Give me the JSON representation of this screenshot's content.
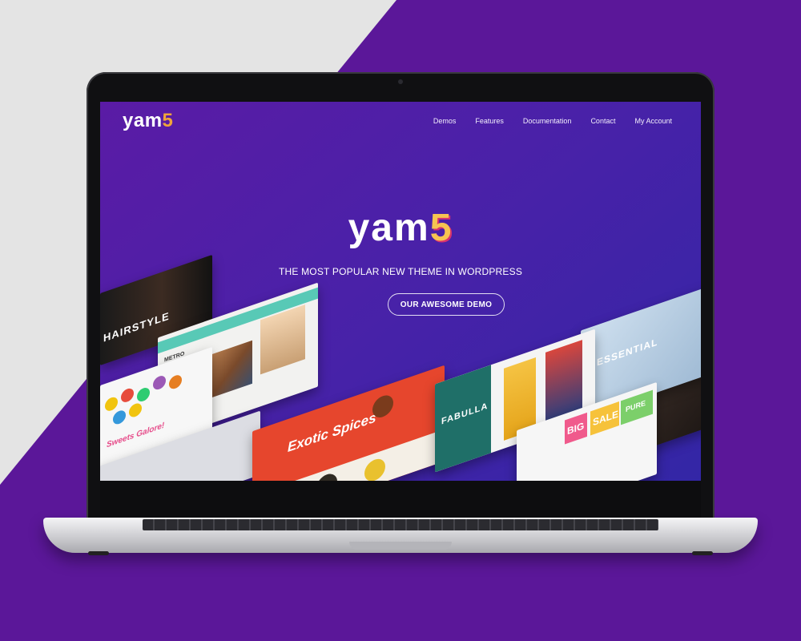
{
  "site": {
    "logo_text": "yam",
    "logo_suffix": "5",
    "nav": [
      "Demos",
      "Features",
      "Documentation",
      "Contact",
      "My Account"
    ]
  },
  "hero": {
    "logo_text": "yam",
    "logo_suffix": "5",
    "tagline": "THE MOST POPULAR NEW THEME IN WORDPRESS",
    "cta_label": "OUR AWESOME DEMO"
  },
  "demos": {
    "hairstyle": "HAIRSTYLE",
    "metro": "METRO",
    "sweets": "Sweets Galore!",
    "spices": "Exotic Spices",
    "fashion": "FABULLA",
    "big": "BIG",
    "sale": "SALE",
    "pure": "PURE",
    "essential": "ESSENTIAL"
  },
  "colors": {
    "brand_purple": "#5b1799",
    "accent_orange": "#f0a43a",
    "screen_gradient_start": "#5a1ba5",
    "screen_gradient_end": "#3326a6"
  }
}
